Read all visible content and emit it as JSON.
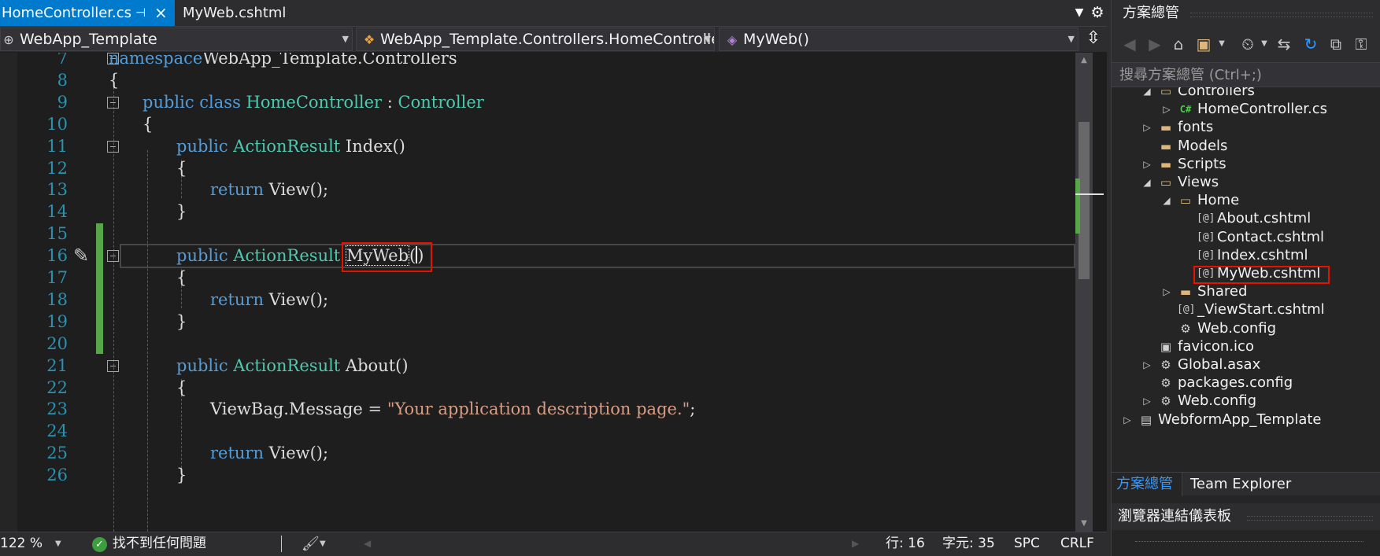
{
  "tabs": [
    {
      "label": "HomeController.cs",
      "active": true
    },
    {
      "label": "MyWeb.cshtml",
      "active": false
    }
  ],
  "tab_pin_icon": "pin-icon",
  "tab_close_icon": "close-icon",
  "navigation": {
    "project": "WebApp_Template",
    "class": "WebApp_Template.Controllers.HomeController",
    "member": "MyWeb()"
  },
  "code_lines": [
    {
      "n": "7",
      "fold": true,
      "indent": 0,
      "parts": [
        [
          "kw",
          "namespace"
        ],
        [
          "",
          "WebApp_Template.Controllers"
        ]
      ]
    },
    {
      "n": "8",
      "fold": false,
      "indent": 0,
      "parts": [
        [
          "",
          "{"
        ]
      ]
    },
    {
      "n": "9",
      "fold": true,
      "indent": 1,
      "parts": [
        [
          "kw",
          "public"
        ],
        [
          "",
          " "
        ],
        [
          "kw",
          "class"
        ],
        [
          "",
          " "
        ],
        [
          "ty",
          "HomeController"
        ],
        [
          "",
          " : "
        ],
        [
          "ty",
          "Controller"
        ]
      ]
    },
    {
      "n": "10",
      "fold": false,
      "indent": 1,
      "parts": [
        [
          "",
          "{"
        ]
      ]
    },
    {
      "n": "11",
      "fold": true,
      "indent": 2,
      "parts": [
        [
          "kw",
          "public"
        ],
        [
          "",
          " "
        ],
        [
          "ty",
          "ActionResult"
        ],
        [
          "",
          " Index()"
        ]
      ]
    },
    {
      "n": "12",
      "fold": false,
      "indent": 2,
      "parts": [
        [
          "",
          "{"
        ]
      ]
    },
    {
      "n": "13",
      "fold": false,
      "indent": 3,
      "parts": [
        [
          "kw",
          "return"
        ],
        [
          "",
          " View();"
        ]
      ]
    },
    {
      "n": "14",
      "fold": false,
      "indent": 2,
      "parts": [
        [
          "",
          "}"
        ]
      ]
    },
    {
      "n": "15",
      "fold": false,
      "indent": 0,
      "parts": []
    },
    {
      "n": "16",
      "fold": true,
      "indent": 2,
      "current": true,
      "parts": [
        [
          "kw",
          "public"
        ],
        [
          "",
          " "
        ],
        [
          "ty",
          "ActionResult"
        ],
        [
          "",
          " "
        ],
        [
          "rename",
          "MyWeb"
        ],
        [
          "",
          "("
        ],
        [
          "caret",
          ""
        ],
        [
          "",
          ")"
        ]
      ]
    },
    {
      "n": "17",
      "fold": false,
      "indent": 2,
      "parts": [
        [
          "",
          "{"
        ]
      ]
    },
    {
      "n": "18",
      "fold": false,
      "indent": 3,
      "parts": [
        [
          "kw",
          "return"
        ],
        [
          "",
          " View();"
        ]
      ]
    },
    {
      "n": "19",
      "fold": false,
      "indent": 2,
      "parts": [
        [
          "",
          "}"
        ]
      ]
    },
    {
      "n": "20",
      "fold": false,
      "indent": 0,
      "parts": []
    },
    {
      "n": "21",
      "fold": true,
      "indent": 2,
      "parts": [
        [
          "kw",
          "public"
        ],
        [
          "",
          " "
        ],
        [
          "ty",
          "ActionResult"
        ],
        [
          "",
          " About()"
        ]
      ]
    },
    {
      "n": "22",
      "fold": false,
      "indent": 2,
      "parts": [
        [
          "",
          "{"
        ]
      ]
    },
    {
      "n": "23",
      "fold": false,
      "indent": 3,
      "parts": [
        [
          "",
          "ViewBag.Message = "
        ],
        [
          "st",
          "\"Your application description page.\""
        ],
        [
          "",
          ";"
        ]
      ]
    },
    {
      "n": "24",
      "fold": false,
      "indent": 0,
      "parts": []
    },
    {
      "n": "25",
      "fold": false,
      "indent": 3,
      "parts": [
        [
          "kw",
          "return"
        ],
        [
          "",
          " View();"
        ]
      ]
    },
    {
      "n": "26",
      "fold": false,
      "indent": 2,
      "parts": [
        [
          "",
          "}"
        ]
      ]
    }
  ],
  "status": {
    "zoom": "122 %",
    "issues": "找不到任何問題",
    "line": "行: 16",
    "char": "字元: 35",
    "insert_mode": "SPC",
    "eol": "CRLF"
  },
  "solution_explorer": {
    "title": "方案總管",
    "search_placeholder": "搜尋方案總管 (Ctrl+;)",
    "tree": [
      {
        "label": "Controllers",
        "level": 2,
        "expander": "expanded",
        "icon": "folder-open-icon"
      },
      {
        "label": "HomeController.cs",
        "level": 3,
        "expander": "collapsed",
        "icon": "csharp-file-icon"
      },
      {
        "label": "fonts",
        "level": 2,
        "expander": "collapsed",
        "icon": "folder-icon"
      },
      {
        "label": "Models",
        "level": 2,
        "expander": "none",
        "icon": "folder-icon"
      },
      {
        "label": "Scripts",
        "level": 2,
        "expander": "collapsed",
        "icon": "folder-icon"
      },
      {
        "label": "Views",
        "level": 2,
        "expander": "expanded",
        "icon": "folder-open-icon"
      },
      {
        "label": "Home",
        "level": 3,
        "expander": "expanded",
        "icon": "folder-open-icon"
      },
      {
        "label": "About.cshtml",
        "level": 4,
        "expander": "none",
        "icon": "razor-file-icon"
      },
      {
        "label": "Contact.cshtml",
        "level": 4,
        "expander": "none",
        "icon": "razor-file-icon"
      },
      {
        "label": "Index.cshtml",
        "level": 4,
        "expander": "none",
        "icon": "razor-file-icon"
      },
      {
        "label": "MyWeb.cshtml",
        "level": 4,
        "expander": "none",
        "icon": "razor-file-icon",
        "highlight": true
      },
      {
        "label": "Shared",
        "level": 3,
        "expander": "collapsed",
        "icon": "folder-icon"
      },
      {
        "label": "_ViewStart.cshtml",
        "level": 3,
        "expander": "none",
        "icon": "razor-file-icon"
      },
      {
        "label": "Web.config",
        "level": 3,
        "expander": "none",
        "icon": "config-file-icon"
      },
      {
        "label": "favicon.ico",
        "level": 2,
        "expander": "none",
        "icon": "image-file-icon"
      },
      {
        "label": "Global.asax",
        "level": 2,
        "expander": "collapsed",
        "icon": "asax-file-icon"
      },
      {
        "label": "packages.config",
        "level": 2,
        "expander": "none",
        "icon": "config-file-icon"
      },
      {
        "label": "Web.config",
        "level": 2,
        "expander": "collapsed",
        "icon": "config-file-icon"
      },
      {
        "label": "WebformApp_Template",
        "level": 1,
        "expander": "collapsed",
        "icon": "project-icon"
      }
    ],
    "tabs": [
      "方案總管",
      "Team Explorer"
    ]
  },
  "browser_link": {
    "title": "瀏覽器連結儀表板"
  },
  "colors": {
    "accent": "#007acc",
    "highlight_box": "#e51400",
    "change_bar": "#57a64a",
    "keyword": "#569cd6",
    "type": "#4ec9b0",
    "string": "#d69d85",
    "line_number": "#2b91af"
  }
}
